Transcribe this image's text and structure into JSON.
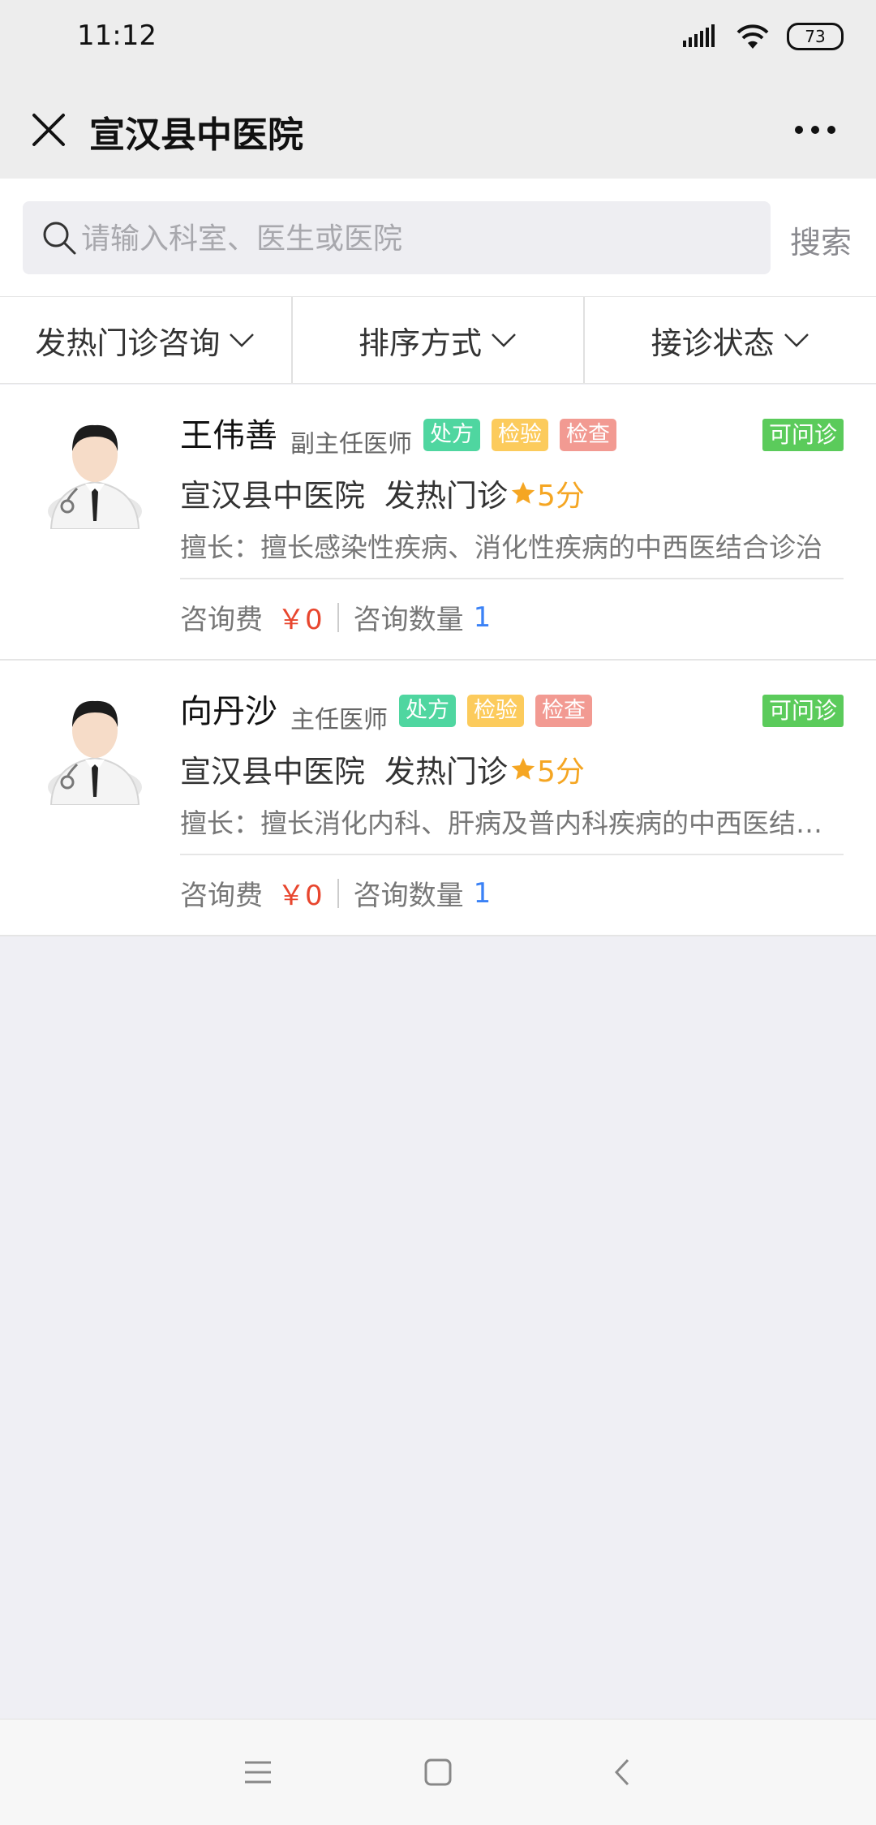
{
  "status_bar": {
    "time": "11:12",
    "battery": "73"
  },
  "nav": {
    "title": "宣汉县中医院"
  },
  "search": {
    "placeholder": "请输入科室、医生或医院",
    "button": "搜索"
  },
  "filters": [
    {
      "label": "发热门诊咨询"
    },
    {
      "label": "排序方式"
    },
    {
      "label": "接诊状态"
    }
  ],
  "doctors": [
    {
      "name": "王伟善",
      "title": "副主任医师",
      "tags": [
        "处方",
        "检验",
        "检查"
      ],
      "availability": "可问诊",
      "hospital": "宣汉县中医院",
      "department": "发热门诊",
      "rating": "5分",
      "specialty": "擅长：擅长感染性疾病、消化性疾病的中西医结合诊治",
      "fee_label": "咨询费",
      "fee": "￥0",
      "count_label": "咨询数量",
      "count": "1"
    },
    {
      "name": "向丹沙",
      "title": "主任医师",
      "tags": [
        "处方",
        "检验",
        "检查"
      ],
      "availability": "可问诊",
      "hospital": "宣汉县中医院",
      "department": "发热门诊",
      "rating": "5分",
      "specialty": "擅长：擅长消化内科、肝病及普内科疾病的中西医结合诊治",
      "fee_label": "咨询费",
      "fee": "￥0",
      "count_label": "咨询数量",
      "count": "1"
    }
  ],
  "colors": {
    "available": "#5bcb5b",
    "tag_prescription": "#4fd6a0",
    "tag_lab": "#fccb5c",
    "tag_exam": "#f29a92",
    "fee": "#e8462e",
    "count": "#3b82f6",
    "rating": "#f5a623"
  }
}
